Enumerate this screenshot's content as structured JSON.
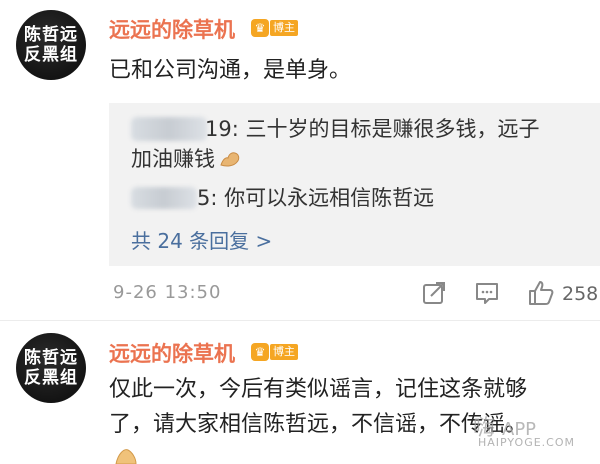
{
  "comments": [
    {
      "avatar_line1": "陈哲远",
      "avatar_line2": "反黑组",
      "username": "远远的除草机",
      "badge": "博主",
      "text": "已和公司沟通，是单身。",
      "replies": [
        {
          "suffix": "19: 三十岁的目标是赚很多钱，远子",
          "continuation": "加油赚钱",
          "emoji": "flexed-biceps-icon"
        },
        {
          "suffix": "5: 你可以永远相信陈哲远"
        }
      ],
      "more_replies": "共 24 条回复 >",
      "time": "9-26 13:50",
      "like_count": "258"
    },
    {
      "avatar_line1": "陈哲远",
      "avatar_line2": "反黑组",
      "username": "远远的除草机",
      "badge": "博主",
      "text_line1": "仅此一次，今后有类似谣言，记住这条就够",
      "text_line2": "了，请大家相信陈哲远，不信谣，不传谣。"
    }
  ],
  "watermark": {
    "main": "嗨",
    "app": "APP",
    "domain": "HAIPYOGE.COM"
  },
  "colors": {
    "username": "#eb7350",
    "link": "#4a6f9e",
    "badge": "#f5a623",
    "reply_bg": "#f2f2f2"
  }
}
